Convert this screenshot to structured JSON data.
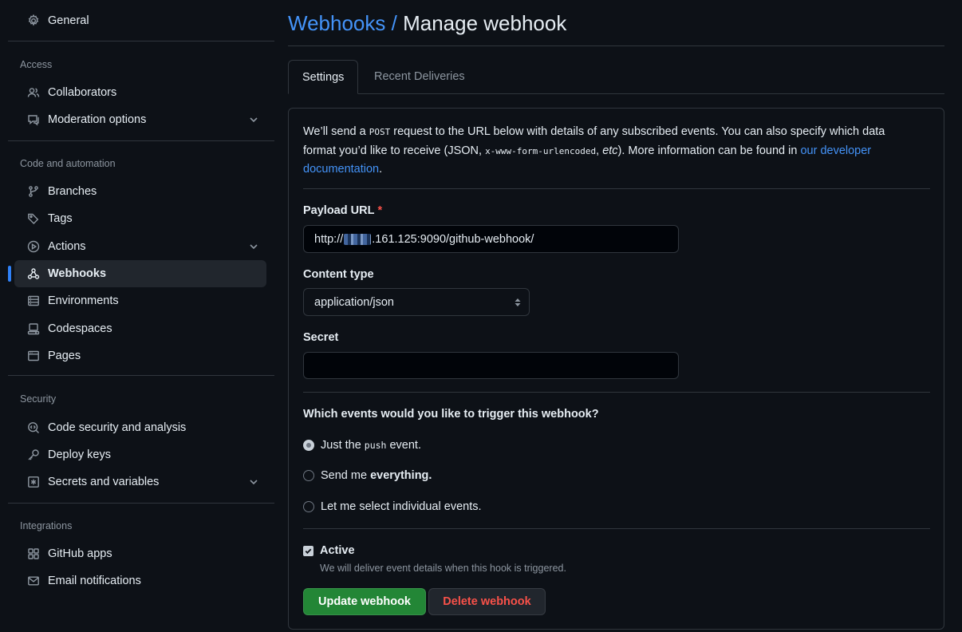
{
  "sidebar": {
    "general": "General",
    "groups": [
      {
        "title": "Access",
        "items": [
          {
            "label": "Collaborators",
            "icon": "people-icon"
          },
          {
            "label": "Moderation options",
            "icon": "comment-icon",
            "expandable": true
          }
        ]
      },
      {
        "title": "Code and automation",
        "items": [
          {
            "label": "Branches",
            "icon": "branch-icon"
          },
          {
            "label": "Tags",
            "icon": "tag-icon"
          },
          {
            "label": "Actions",
            "icon": "play-icon",
            "expandable": true
          },
          {
            "label": "Webhooks",
            "icon": "webhook-icon",
            "selected": true
          },
          {
            "label": "Environments",
            "icon": "server-icon"
          },
          {
            "label": "Codespaces",
            "icon": "codespaces-icon"
          },
          {
            "label": "Pages",
            "icon": "browser-icon"
          }
        ]
      },
      {
        "title": "Security",
        "items": [
          {
            "label": "Code security and analysis",
            "icon": "codescan-icon"
          },
          {
            "label": "Deploy keys",
            "icon": "key-icon"
          },
          {
            "label": "Secrets and variables",
            "icon": "asterisk-icon",
            "expandable": true
          }
        ]
      },
      {
        "title": "Integrations",
        "items": [
          {
            "label": "GitHub apps",
            "icon": "apps-icon"
          },
          {
            "label": "Email notifications",
            "icon": "mail-icon"
          }
        ]
      }
    ]
  },
  "header": {
    "crumb": "Webhooks",
    "separator": "/",
    "title": "Manage webhook"
  },
  "tabs": {
    "settings": "Settings",
    "recent": "Recent Deliveries"
  },
  "intro": {
    "p1": "We’ll send a ",
    "post": "POST",
    "p2": " request to the URL below with details of any subscribed events. You can also specify which data format you’d like to receive (JSON, ",
    "form": "x-www-form-urlencoded",
    "p3": ", ",
    "etc": "etc",
    "p4": "). More information can be found in ",
    "link": "our developer documentation",
    "p5": "."
  },
  "form": {
    "payload_label": "Payload URL",
    "required_mark": "*",
    "payload_prefix": "http://",
    "payload_suffix": ".161.125:9090/github-webhook/",
    "content_type_label": "Content type",
    "content_type_value": "application/json",
    "secret_label": "Secret",
    "secret_value": "",
    "events_question": "Which events would you like to trigger this webhook?",
    "option1_pre": "Just the",
    "option1_code": "push",
    "option1_post": "event.",
    "option2_pre": "Send me",
    "option2_bold": "everything.",
    "option3": "Let me select individual events.",
    "selected_option": 1,
    "active_label": "Active",
    "active_checked": true,
    "active_note": "We will deliver event details when this hook is triggered.",
    "update_button": "Update webhook",
    "delete_button": "Delete webhook"
  },
  "colors": {
    "background": "#0d1117",
    "accent": "#2f81f7",
    "link": "#4493f8",
    "primary_button": "#238636",
    "danger": "#f85149"
  }
}
